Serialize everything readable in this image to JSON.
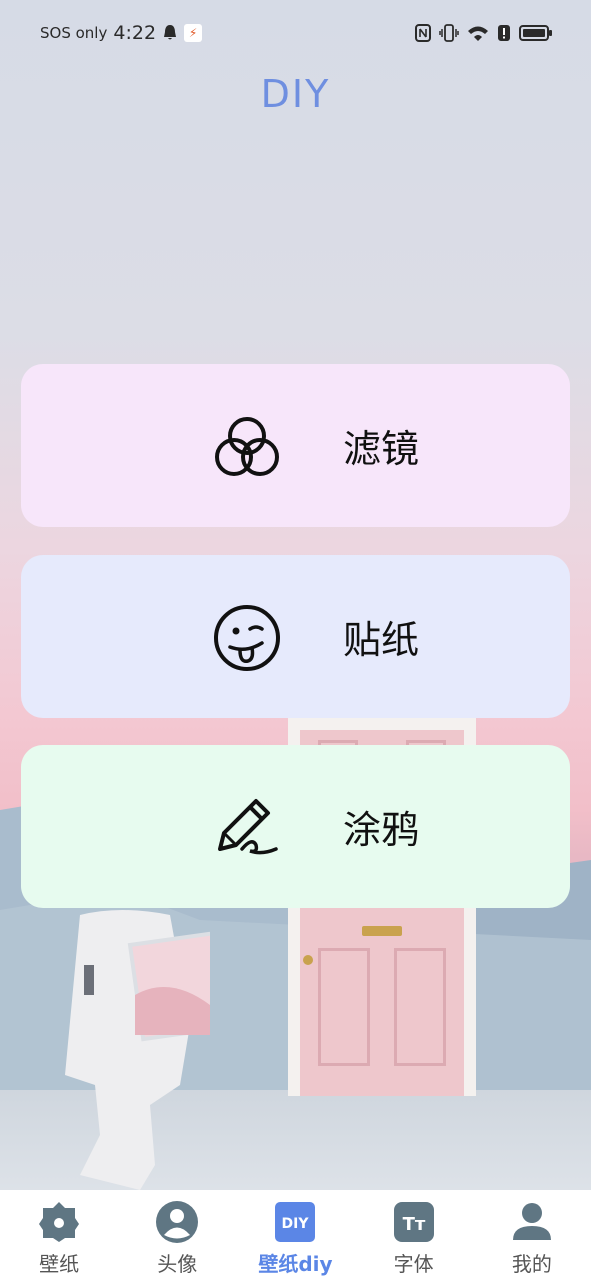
{
  "status_bar": {
    "carrier": "SOS only",
    "time": "4:22",
    "icons": [
      "bell-icon",
      "app-notification-icon",
      "nfc-icon",
      "vibrate-icon",
      "wifi-icon",
      "alert-icon",
      "battery-icon"
    ]
  },
  "title": "DIY",
  "cards": [
    {
      "label": "滤镜",
      "icon": "three-circles-icon",
      "color": "#f7e6fa"
    },
    {
      "label": "贴纸",
      "icon": "tongue-face-icon",
      "color": "#e6eafc"
    },
    {
      "label": "涂鸦",
      "icon": "pen-scribble-icon",
      "color": "#e7fbef"
    }
  ],
  "tabs": [
    {
      "label": "壁纸",
      "icon": "flower-badge-icon"
    },
    {
      "label": "头像",
      "icon": "avatar-circle-icon"
    },
    {
      "label": "壁纸diy",
      "icon": "diy-badge-icon",
      "icon_text": "DIY",
      "active": true
    },
    {
      "label": "字体",
      "icon": "font-tt-icon",
      "icon_text": "Tт"
    },
    {
      "label": "我的",
      "icon": "person-icon"
    }
  ],
  "colors": {
    "accent": "#5b86e6",
    "title": "#6f8fe0",
    "icon_inactive": "#5f7683"
  }
}
